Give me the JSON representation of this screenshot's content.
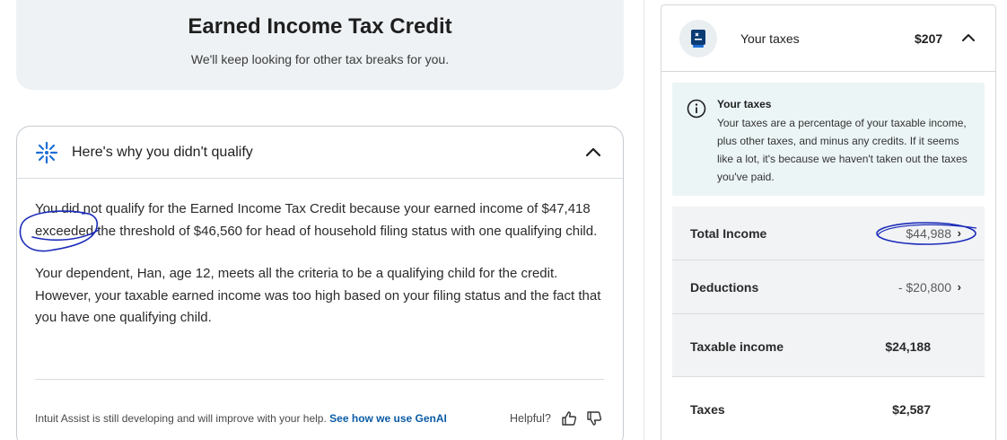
{
  "credit_header": {
    "title": "Earned Income Tax Credit",
    "subtitle": "We'll keep looking for other tax breaks for you."
  },
  "why_card": {
    "title": "Here's why you didn't qualify",
    "paragraph_1": "You did not qualify for the Earned Income Tax Credit because your earned income of $47,418 exceeded the threshold of $46,560 for head of household filing status with one qualifying child.",
    "paragraph_2": "Your dependent, Han, age 12, meets all the criteria to be a qualifying child for the credit. However, your taxable earned income was too high based on your filing status and the fact that you have one qualifying child.",
    "footer_text": "Intuit Assist is still developing and will improve with your help.",
    "footer_link": "See how we use GenAI",
    "helpful_label": "Helpful?"
  },
  "tax_summary": {
    "header_label": "Your taxes",
    "header_amount": "$207",
    "info_title": "Your taxes",
    "info_text": "Your taxes are a percentage of your taxable income, plus other taxes, and minus any credits. If it seems like a lot, it's because we haven't taken out the taxes you've paid.",
    "rows": [
      {
        "label": "Total Income",
        "amount": "$44,988"
      },
      {
        "label": "Deductions",
        "amount": "- $20,800"
      },
      {
        "label": "Taxable income",
        "amount": "$24,188"
      },
      {
        "label": "Taxes",
        "amount": "$2,587"
      }
    ],
    "chevron_right": "›"
  },
  "colors": {
    "hero_bg": "#eef2f4",
    "info_bg": "#ecf5f6",
    "link": "#0b5ca6",
    "annotation_ink": "#1a2bb8"
  },
  "icons": [
    "sparkle-icon",
    "chevron-up-icon",
    "thumbs-up-icon",
    "thumbs-down-icon",
    "tax-badge-icon",
    "info-icon",
    "chevron-right-icon"
  ]
}
